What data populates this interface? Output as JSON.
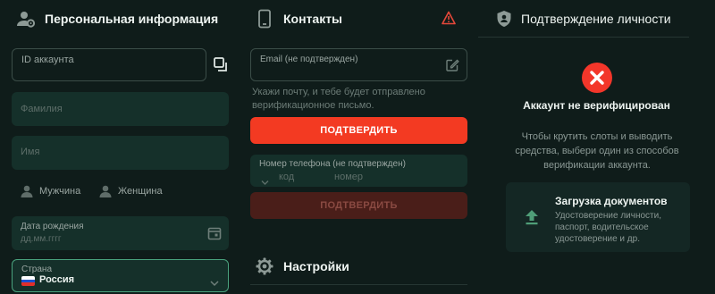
{
  "personal": {
    "title": "Персональная информация",
    "account_id_label": "ID аккаунта",
    "lastname_placeholder": "Фамилия",
    "firstname_placeholder": "Имя",
    "gender_male": "Мужчина",
    "gender_female": "Женщина",
    "birthdate_label": "Дата рождения",
    "birthdate_placeholder": "дд.мм.гггг",
    "country_label": "Страна",
    "country_value": "Россия"
  },
  "contacts": {
    "title": "Контакты",
    "email_label": "Email (не подтвержден)",
    "email_hint": "Укажи почту, и тебе будет отправлено верификационное письмо.",
    "confirm_email_button": "ПОДТВЕРДИТЬ",
    "phone_label": "Номер телефона (не подтвержден)",
    "phone_code_placeholder": "код",
    "phone_number_placeholder": "номер",
    "confirm_phone_button": "ПОДТВЕРДИТЬ"
  },
  "settings": {
    "title": "Настройки"
  },
  "verification": {
    "title": "Подтверждение личности",
    "status": "Аккаунт не верифицирован",
    "description": "Чтобы крутить слоты и выводить средства, выбери один из способов верификации аккаунта.",
    "upload_title": "Загрузка документов",
    "upload_description": "Удостоверение личности, паспорт, водительское удостоверение и др."
  },
  "colors": {
    "background": "#0f1c1a",
    "field": "#15302a",
    "accent_red": "#f33a22",
    "accent_green": "#4aa27e",
    "warning": "#e5483a"
  },
  "icons": {
    "personal": "user-gear-icon",
    "copy": "copy-icon",
    "user_male": "user-icon",
    "user_female": "user-icon",
    "calendar": "calendar-icon",
    "flag": "russia-flag-icon",
    "chevron": "chevron-down-icon",
    "phone": "smartphone-icon",
    "warning": "warning-triangle-icon",
    "edit": "edit-icon",
    "settings": "gear-icon",
    "shield": "shield-user-icon",
    "status": "close-circle-icon",
    "upload": "upload-arrow-icon"
  }
}
